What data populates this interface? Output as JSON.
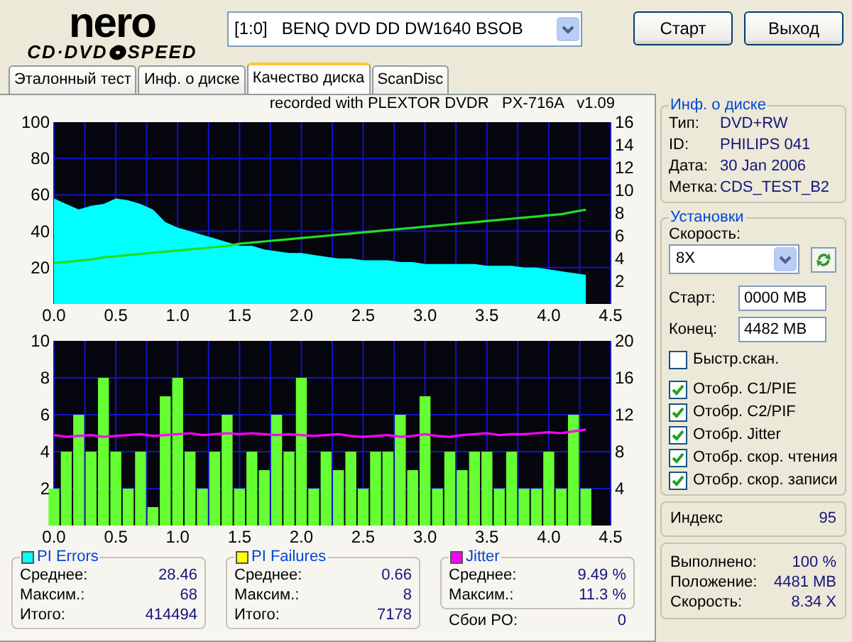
{
  "logo": {
    "brand": "nero",
    "product_left": "CD·DVD",
    "product_right": "SPEED"
  },
  "drive_select": {
    "value": "[1:0]   BENQ DVD DD DW1640 BSOB"
  },
  "buttons": [
    {
      "label": "Старт"
    },
    {
      "label": "Выход"
    }
  ],
  "tabs": [
    {
      "label": "Эталонный тест",
      "selected": false
    },
    {
      "label": "Инф. о диске",
      "selected": false
    },
    {
      "label": "Качество диска",
      "selected": true
    },
    {
      "label": "ScanDisc",
      "selected": false
    }
  ],
  "charts": [
    {
      "subtitle": "recorded with PLEXTOR DVDR   PX-716A   v1.09",
      "chart_data": {
        "type": "area",
        "x": [
          0,
          0.1,
          0.2,
          0.3,
          0.4,
          0.5,
          0.6,
          0.7,
          0.8,
          0.9,
          1,
          1.1,
          1.2,
          1.3,
          1.4,
          1.5,
          1.6,
          1.7,
          1.8,
          1.9,
          2,
          2.1,
          2.2,
          2.3,
          2.4,
          2.5,
          2.6,
          2.7,
          2.8,
          2.9,
          3,
          3.1,
          3.2,
          3.3,
          3.4,
          3.5,
          3.6,
          3.7,
          3.8,
          3.9,
          4,
          4.1,
          4.2,
          4.3
        ],
        "series": [
          {
            "color": "#00ffff",
            "values": [
              58,
              55,
              52,
              54,
              55,
              58,
              57,
              55,
              52,
              45,
              42,
              40,
              38,
              36,
              34,
              32,
              32,
              30,
              29,
              28,
              28,
              27,
              26,
              25,
              25,
              24,
              24,
              24,
              23,
              23,
              22,
              22,
              22,
              22,
              22,
              21,
              21,
              21,
              20,
              20,
              19,
              18,
              17,
              16
            ]
          },
          {
            "type": "line",
            "axis": "y2",
            "color": "#22dd22",
            "values": [
              3.6,
              3.7,
              3.8,
              3.9,
              4.1,
              4.2,
              4.3,
              4.4,
              4.5,
              4.6,
              4.7,
              4.8,
              4.9,
              5.0,
              5.1,
              5.3,
              5.4,
              5.5,
              5.6,
              5.7,
              5.8,
              5.9,
              6.0,
              6.1,
              6.2,
              6.3,
              6.4,
              6.5,
              6.6,
              6.7,
              6.8,
              6.9,
              7.0,
              7.1,
              7.2,
              7.3,
              7.4,
              7.5,
              7.6,
              7.7,
              7.8,
              7.9,
              8.1,
              8.3
            ]
          }
        ],
        "xlim": [
          0,
          4.5
        ],
        "ylim": [
          0,
          100
        ],
        "y2lim": [
          0,
          16
        ],
        "grid": true,
        "xticks": [
          {
            "value": 0,
            "label": "0.0"
          },
          {
            "value": 0.5,
            "label": "0.5"
          },
          {
            "value": 1,
            "label": "1.0"
          },
          {
            "value": 1.5,
            "label": "1.5"
          },
          {
            "value": 2,
            "label": "2.0"
          },
          {
            "value": 2.5,
            "label": "2.5"
          },
          {
            "value": 3,
            "label": "3.0"
          },
          {
            "value": 3.5,
            "label": "3.5"
          },
          {
            "value": 4,
            "label": "4.0"
          },
          {
            "value": 4.5,
            "label": "4.5"
          }
        ],
        "yticks": [
          20,
          40,
          60,
          80,
          100
        ],
        "y2ticks": [
          2,
          4,
          6,
          8,
          10,
          12,
          14,
          16
        ]
      }
    },
    {
      "chart_data": {
        "type": "bar",
        "x": [
          0,
          0.1,
          0.2,
          0.3,
          0.4,
          0.5,
          0.6,
          0.7,
          0.8,
          0.9,
          1,
          1.1,
          1.2,
          1.3,
          1.4,
          1.5,
          1.6,
          1.7,
          1.8,
          1.9,
          2,
          2.1,
          2.2,
          2.3,
          2.4,
          2.5,
          2.6,
          2.7,
          2.8,
          2.9,
          3,
          3.1,
          3.2,
          3.3,
          3.4,
          3.5,
          3.6,
          3.7,
          3.8,
          3.9,
          4,
          4.1,
          4.2,
          4.3
        ],
        "series": [
          {
            "color": "#66ff33",
            "values": [
              2,
              4,
              6,
              4,
              8,
              4,
              2,
              4,
              1,
              7,
              8,
              4,
              2,
              4,
              6,
              2,
              4,
              3,
              6,
              4,
              8,
              2,
              4,
              3,
              4,
              2,
              4,
              4,
              6,
              3,
              7,
              2,
              4,
              3,
              4,
              4,
              2,
              4,
              2,
              2,
              4,
              2,
              6,
              2
            ]
          },
          {
            "type": "line",
            "axis": "y2",
            "color": "#ff00ff",
            "values": [
              9.8,
              9.6,
              9.7,
              9.8,
              9.6,
              9.7,
              9.8,
              9.9,
              9.7,
              9.8,
              9.9,
              10.0,
              9.8,
              9.9,
              10.0,
              9.9,
              10.0,
              9.9,
              9.8,
              9.9,
              9.8,
              9.7,
              9.8,
              9.9,
              9.7,
              9.6,
              9.7,
              9.8,
              9.6,
              9.7,
              9.9,
              9.7,
              9.6,
              9.8,
              9.9,
              10.0,
              9.8,
              9.9,
              9.9,
              10.0,
              10.1,
              10.0,
              10.2,
              10.4
            ]
          }
        ],
        "xlim": [
          0,
          4.5
        ],
        "ylim": [
          0,
          10
        ],
        "y2lim": [
          0,
          20
        ],
        "grid": true,
        "xticks": [
          {
            "value": 0,
            "label": "0.0"
          },
          {
            "value": 0.5,
            "label": "0.5"
          },
          {
            "value": 1,
            "label": "1.0"
          },
          {
            "value": 1.5,
            "label": "1.5"
          },
          {
            "value": 2,
            "label": "2.0"
          },
          {
            "value": 2.5,
            "label": "2.5"
          },
          {
            "value": 3,
            "label": "3.0"
          },
          {
            "value": 3.5,
            "label": "3.5"
          },
          {
            "value": 4,
            "label": "4.0"
          },
          {
            "value": 4.5,
            "label": "4.5"
          }
        ],
        "yticks": [
          2,
          4,
          6,
          8,
          10
        ],
        "y2ticks": [
          4,
          8,
          12,
          16,
          20
        ]
      }
    }
  ],
  "stats": [
    {
      "title": "PI Errors",
      "color": "#00ffff",
      "rows": [
        {
          "label": "Среднее:",
          "value": "28.46"
        },
        {
          "label": "Максим.:",
          "value": "68"
        },
        {
          "label": "Итого:",
          "value": "414494"
        }
      ]
    },
    {
      "title": "PI Failures",
      "color": "#ffff00",
      "rows": [
        {
          "label": "Среднее:",
          "value": "0.66"
        },
        {
          "label": "Максим.:",
          "value": "8"
        },
        {
          "label": "Итого:",
          "value": "7178"
        }
      ]
    },
    {
      "title": "Jitter",
      "color": "#ff00ff",
      "rows": [
        {
          "label": "Среднее:",
          "value": "9.49 %"
        },
        {
          "label": "Максим.:",
          "value": "11.3 %"
        }
      ]
    }
  ],
  "po_failures": {
    "label": "Сбои PO:",
    "value": "0"
  },
  "disc_info": {
    "title": "Инф. о диске",
    "rows": [
      {
        "label": "Тип:",
        "value": "DVD+RW"
      },
      {
        "label": "ID:",
        "value": "PHILIPS 041"
      },
      {
        "label": "Дата:",
        "value": "30 Jan 2006"
      },
      {
        "label": "Метка:",
        "value": "CDS_TEST_B2"
      }
    ]
  },
  "settings": {
    "title": "Установки",
    "speed_label": "Скорость:",
    "speed_value": "8X",
    "start_label": "Старт:",
    "start_value": "0000 MB",
    "end_label": "Конец:",
    "end_value": "4482 MB",
    "options": [
      {
        "label": "Быстр.скан.",
        "checked": false
      },
      {
        "label": "Отобр. C1/PIE",
        "checked": true
      },
      {
        "label": "Отобр. C2/PIF",
        "checked": true
      },
      {
        "label": "Отобр. Jitter",
        "checked": true
      },
      {
        "label": "Отобр. скор. чтения",
        "checked": true
      },
      {
        "label": "Отобр. скор. записи",
        "checked": true
      }
    ]
  },
  "index": {
    "label": "Индекс",
    "value": "95"
  },
  "progress": [
    {
      "label": "Выполнено:",
      "value": "100 %"
    },
    {
      "label": "Положение:",
      "value": "4481 MB"
    },
    {
      "label": "Скорость:",
      "value": "8.34 X"
    }
  ]
}
